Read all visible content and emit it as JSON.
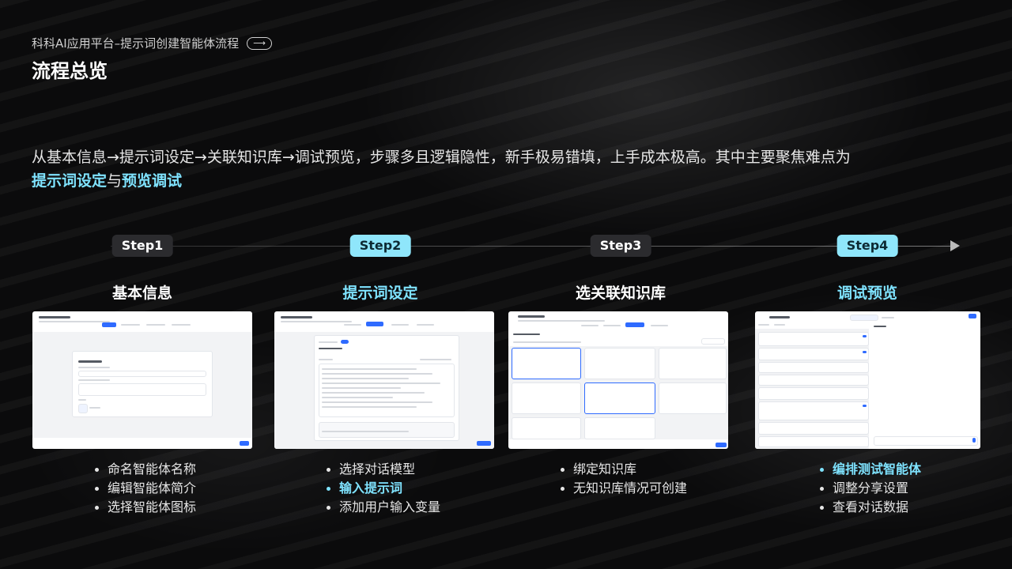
{
  "header": {
    "breadcrumb": "科科AI应用平台–提示词创建智能体流程",
    "title": "流程总览"
  },
  "description": {
    "text": "从基本信息→提示词设定→关联知识库→调试预览，步骤多且逻辑隐性，新手极易错填，上手成本极高。其中主要聚焦难点为",
    "highlight1": "提示词设定",
    "joiner": "与",
    "highlight2": "预览调试"
  },
  "steps": [
    {
      "badge": "Step1",
      "title": "基本信息",
      "bullets": [
        "命名智能体名称",
        "编辑智能体简介",
        "选择智能体图标"
      ]
    },
    {
      "badge": "Step2",
      "title": "提示词设定",
      "bullets": [
        "选择对话模型",
        "输入提示词",
        "添加用户输入变量"
      ]
    },
    {
      "badge": "Step3",
      "title": "选关联知识库",
      "bullets": [
        "绑定知识库",
        "无知识库情况可创建"
      ]
    },
    {
      "badge": "Step4",
      "title": "调试预览",
      "bullets": [
        "编排测试智能体",
        "调整分享设置",
        "查看对话数据"
      ]
    }
  ],
  "colors": {
    "accent": "#7fe3ff",
    "badge_active": "#8fe6fb",
    "badge_inactive": "#2b2b2e"
  }
}
